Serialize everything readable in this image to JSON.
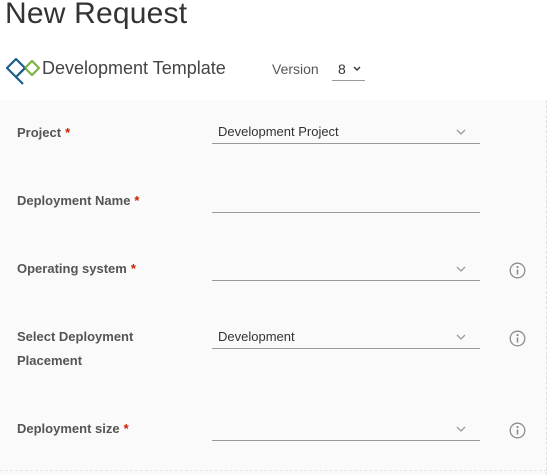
{
  "header": {
    "title": "New Request"
  },
  "blueprint": {
    "name": "Development Template",
    "logo_icon": "blueprint-cloud-template-icon",
    "version_label": "Version",
    "version_value": "8"
  },
  "form": {
    "fields": [
      {
        "label": "Project",
        "required": "*",
        "type": "select",
        "value": "Development Project",
        "info": false
      },
      {
        "label": "Deployment Name",
        "required": "*",
        "type": "text",
        "value": "",
        "info": false
      },
      {
        "label": "Operating system",
        "required": "*",
        "type": "select",
        "value": "",
        "info": true
      },
      {
        "label_line1": "Select Deployment",
        "label_line2": "Placement",
        "type": "select",
        "value": "Development",
        "info": true
      },
      {
        "label": "Deployment size",
        "required": "*",
        "type": "select",
        "value": "",
        "info": true
      }
    ]
  },
  "colors": {
    "required_asterisk": "#c92100",
    "logo_blue": "#1b5e8c",
    "logo_green": "#7cb342",
    "underline": "#9a9a9a"
  }
}
